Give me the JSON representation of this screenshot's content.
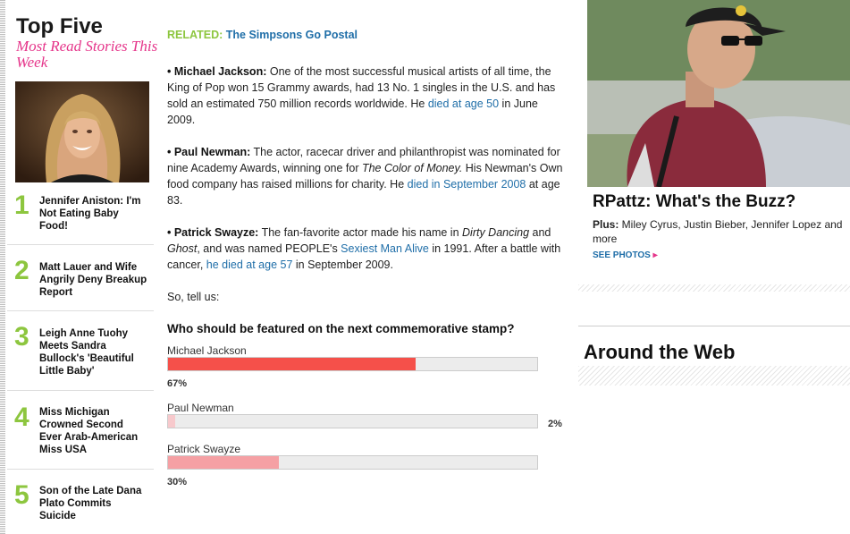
{
  "sidebar": {
    "title": "Top Five",
    "subtitle": "Most Read Stories This Week",
    "items": [
      {
        "num": "1",
        "text": "Jennifer Aniston: I'm Not Eating Baby Food!"
      },
      {
        "num": "2",
        "text": "Matt Lauer and Wife Angrily Deny Breakup Report"
      },
      {
        "num": "3",
        "text": "Leigh Anne Tuohy Meets Sandra Bullock's 'Beautiful Little Baby'"
      },
      {
        "num": "4",
        "text": "Miss Michigan Crowned Second Ever Arab-American Miss USA"
      },
      {
        "num": "5",
        "text": "Son of the Late Dana Plato Commits Suicide"
      }
    ]
  },
  "article": {
    "related_label": "RELATED:",
    "related_link": "The Simpsons Go Postal",
    "p1": {
      "name": "• Michael Jackson:",
      "text": " One of the most successful musical artists of all time, the King of Pop won 15 Grammy awards, had 13 No. 1 singles in the U.S. and has sold an estimated 750 million records worldwide. He ",
      "link": "died at age 50",
      "tail": " in June 2009."
    },
    "p2": {
      "name": "• Paul Newman:",
      "text": " The actor, racecar driver and philanthropist was nominated for nine Academy Awards, winning one for ",
      "italic": "The Color of Money.",
      "text2": " His Newman's Own food company has raised millions for charity. He ",
      "link": "died in September 2008",
      "tail": " at age 83."
    },
    "p3": {
      "name": "• Patrick Swayze:",
      "text": " The fan-favorite actor made his name in ",
      "italic1": "Dirty Dancing",
      "text2": " and ",
      "italic2": "Ghost",
      "text3": ", and was named PEOPLE's ",
      "link1": "Sexiest Man Alive",
      "text4": " in 1991. After a battle with cancer, ",
      "link2": "he died at age 57",
      "tail": " in September 2009."
    },
    "so_tell": "So, tell us:"
  },
  "poll": {
    "question": "Who should be featured on the next commemorative stamp?",
    "options": [
      {
        "name": "Michael Jackson",
        "pct_label": "67%",
        "fraction": 0.67,
        "color": "#f5504a"
      },
      {
        "name": "Paul Newman",
        "pct_label": "2%",
        "fraction": 0.02,
        "color": "#f7c9cc"
      },
      {
        "name": "Patrick Swayze",
        "pct_label": "30%",
        "fraction": 0.3,
        "color": "#f5a0a4"
      }
    ]
  },
  "right": {
    "feature_title": "RPattz: What's the Buzz?",
    "plus_label": "Plus:",
    "plus_text": " Miley Cyrus, Justin Bieber, Jennifer Lopez and more",
    "see_photos": "SEE PHOTOS",
    "see_photos_arrow": "▸",
    "around_title": "Around the Web"
  },
  "colors": {
    "accent_green": "#8dc63f",
    "accent_pink": "#e5358a",
    "link_blue": "#1f6ea8"
  }
}
